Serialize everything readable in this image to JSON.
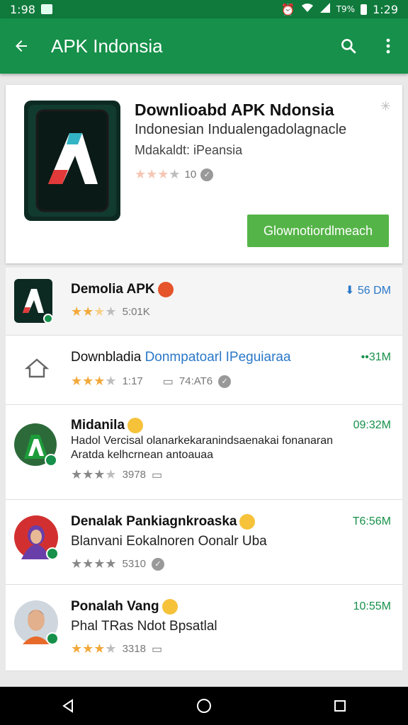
{
  "status_bar": {
    "time_left": "1:98",
    "time_right": "1:29",
    "battery": "T9%"
  },
  "app_bar": {
    "title": "APK Indonsia",
    "icons": [
      "back-arrow-icon",
      "search-icon",
      "more-vert-icon"
    ]
  },
  "featured": {
    "name": "Downlioabd APK Ndonsia",
    "developer": "Indonesian Indualengadolagnacle",
    "subtitle": "Mdakaldt: iPeansia",
    "rating_count": "10",
    "rating": 3.5,
    "install_label": "Glownotiordlmeach"
  },
  "list": [
    {
      "title": "Demolia APK",
      "desc": "",
      "rating_count": "5:01K",
      "size": "56 DM",
      "rating": 2.5,
      "thumb": "apk-logo",
      "badge": "red"
    },
    {
      "title": "Downbladia",
      "title_link": "Donmpatoarl IPeguiaraa",
      "desc": "",
      "rating_count": "1:17",
      "rating_extra": "74:AT6",
      "size": "31M",
      "rating": 3,
      "thumb": "home-icon"
    },
    {
      "title": "Midanila",
      "desc": "Hadol Vercisal olanarkekaranindsaenakai fonanaran",
      "desc2": "Aratda kelhcrnean antoauaa",
      "rating_count": "3978",
      "size": "09:32M",
      "rating": 3.5,
      "thumb": "apk-avatar"
    },
    {
      "title": "Denalak Pankiagnkroaska",
      "desc": "Blanvani Eokalnoren Oonalr Uba",
      "rating_count": "5310",
      "size": "T6:56M",
      "rating": 4,
      "thumb": "woman-avatar"
    },
    {
      "title": "Ponalah Vang",
      "desc": "Phal  TRas Ndot Bpsatlal",
      "rating_count": "3318",
      "size": "10:55M",
      "rating": 3,
      "thumb": "man-avatar"
    }
  ],
  "nav_bar": {
    "icons": [
      "back-triangle-icon",
      "home-circle-icon",
      "recents-square-icon"
    ]
  },
  "colors": {
    "primary": "#16904a",
    "status": "#0f7a3c",
    "install": "#55b448",
    "star": "#f2a93b"
  }
}
